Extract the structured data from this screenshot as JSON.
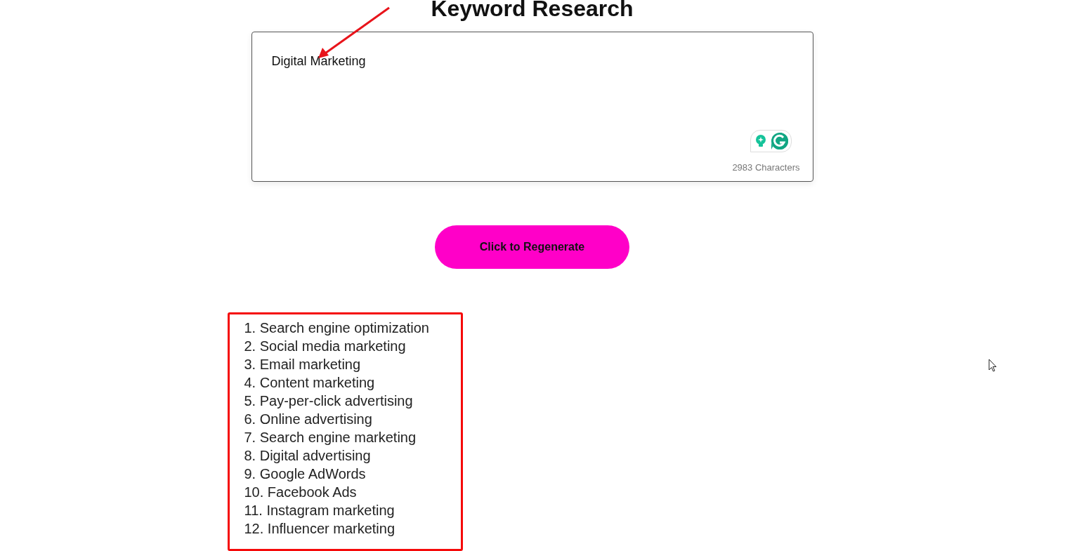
{
  "title": "Keyword Research",
  "editor": {
    "value": "Digital Marketing",
    "counter": "2983 Characters"
  },
  "regenerate_button": {
    "label": "Click to Regenerate"
  },
  "results": [
    "1. Search engine optimization",
    "2. Social media marketing",
    "3. Email marketing",
    "4. Content marketing",
    "5. Pay-per-click advertising",
    "6. Online advertising",
    "7. Search engine marketing",
    "8. Digital advertising",
    "9. Google AdWords",
    "10. Facebook Ads",
    "11. Instagram marketing",
    "12. Influencer marketing"
  ]
}
